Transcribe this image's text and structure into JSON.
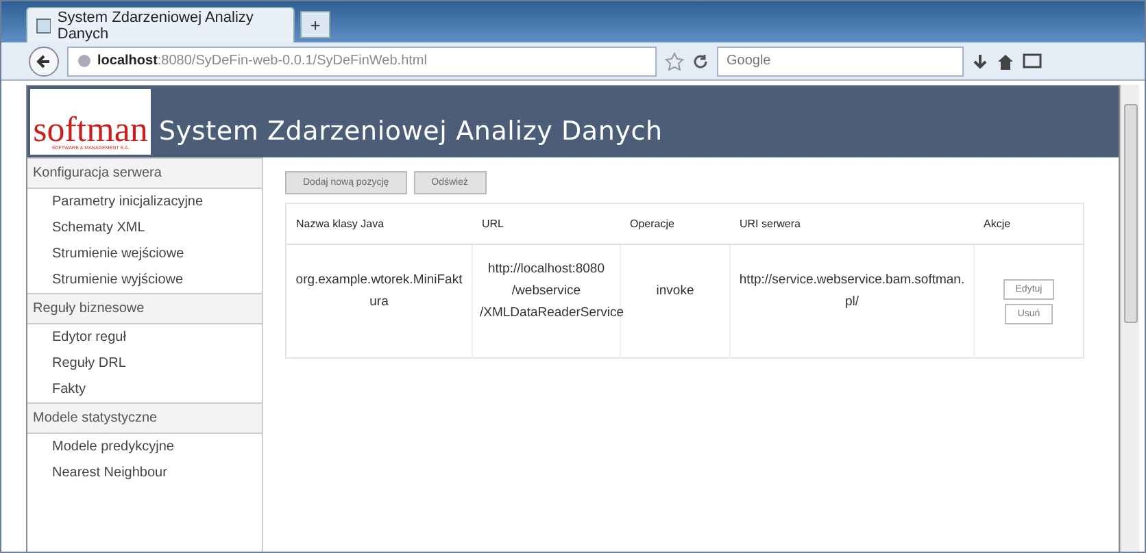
{
  "browser": {
    "tab_title": "System Zdarzeniowej Analizy Danych",
    "new_tab": "+",
    "address": "**localhost**:8080/SyDeFin-web-0.0.1/SyDeFinWeb.html",
    "search_placeholder": "Google"
  },
  "header": {
    "logo": "softman",
    "logo_sub": "SOFTWARE & MANAGEMENT S.A.",
    "title": "System Zdarzeniowej Analizy Danych"
  },
  "sidebar": {
    "groups": [
      {
        "title": "Konfiguracja serwera",
        "items": [
          "Parametry inicjalizacyjne",
          "Schematy XML",
          "Strumienie wejściowe",
          "Strumienie wyjściowe"
        ]
      },
      {
        "title": "Reguły biznesowe",
        "items": [
          "Edytor reguł",
          "Reguły DRL",
          "Fakty"
        ]
      },
      {
        "title": "Modele statystyczne",
        "items": [
          "Modele predykcyjne",
          "Nearest Neighbour"
        ]
      }
    ]
  },
  "toolbar": {
    "buttons": [
      "Dodaj nową pozycję",
      "Odśwież"
    ]
  },
  "table": {
    "columns": [
      "Nazwa klasy Java",
      "URL",
      "Operacje",
      "URI serwera",
      "Akcje"
    ],
    "rows": [
      {
        "class_name": "org.example.wtorek.MiniFaktura",
        "url": "http://localhost:8080 /webservice /XMLDataReaderService",
        "operation": "invoke",
        "server_uri": "http://service.webservice.bam.softman.pl/",
        "actions": [
          "Edytuj",
          "Usuń"
        ]
      }
    ]
  }
}
